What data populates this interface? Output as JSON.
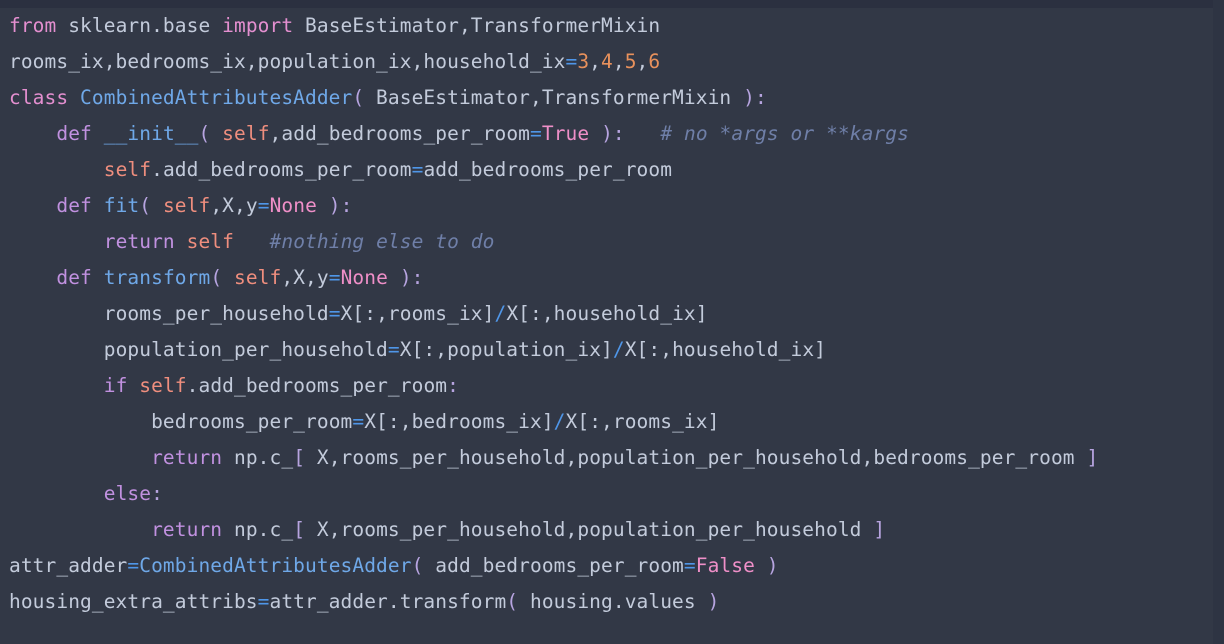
{
  "editor": {
    "language": "python",
    "background_color": "#323846",
    "gutter_color": "#2b3040",
    "scrollbar_color": "#2e3443",
    "theme_colors": {
      "keyword": "#c191e0",
      "keyword_declaration": "#e48fd0",
      "constant": "#ef8fc8",
      "self": "#ef8e7e",
      "function": "#6fa8e8",
      "number": "#e8915c",
      "operator": "#4f96e8",
      "punctuation": "#b7a4e0",
      "identifier": "#c3cbdb",
      "comment": "#6f7fa8"
    }
  },
  "code": {
    "lines": [
      {
        "n": 1,
        "text": "from sklearn.base import BaseEstimator,TransformerMixin",
        "tokens": [
          {
            "t": "from",
            "c": "kw2"
          },
          {
            "t": " sklearn.base ",
            "c": "id"
          },
          {
            "t": "import",
            "c": "kw2"
          },
          {
            "t": " BaseEstimator,TransformerMixin",
            "c": "id"
          }
        ]
      },
      {
        "n": 2,
        "text": "rooms_ix,bedrooms_ix,population_ix,household_ix=3,4,5,6",
        "tokens": [
          {
            "t": "rooms_ix,bedrooms_ix,population_ix,household_ix",
            "c": "id"
          },
          {
            "t": "=",
            "c": "op"
          },
          {
            "t": "3",
            "c": "num"
          },
          {
            "t": ",",
            "c": "id"
          },
          {
            "t": "4",
            "c": "num"
          },
          {
            "t": ",",
            "c": "id"
          },
          {
            "t": "5",
            "c": "num"
          },
          {
            "t": ",",
            "c": "id"
          },
          {
            "t": "6",
            "c": "num"
          }
        ]
      },
      {
        "n": 3,
        "text": "class CombinedAttributesAdder( BaseEstimator,TransformerMixin ):",
        "tokens": [
          {
            "t": "class",
            "c": "kw2"
          },
          {
            "t": " ",
            "c": "id"
          },
          {
            "t": "CombinedAttributesAdder",
            "c": "fn"
          },
          {
            "t": "(",
            "c": "punc"
          },
          {
            "t": " BaseEstimator,TransformerMixin ",
            "c": "id"
          },
          {
            "t": "):",
            "c": "punc"
          }
        ]
      },
      {
        "n": 4,
        "text": "    def __init__( self,add_bedrooms_per_room=True ):   # no *args or **kargs",
        "tokens": [
          {
            "t": "    ",
            "c": "id"
          },
          {
            "t": "def",
            "c": "kw"
          },
          {
            "t": " ",
            "c": "id"
          },
          {
            "t": "__init__",
            "c": "fn"
          },
          {
            "t": "(",
            "c": "punc"
          },
          {
            "t": " ",
            "c": "id"
          },
          {
            "t": "self",
            "c": "self"
          },
          {
            "t": ",add_bedrooms_per_room",
            "c": "id"
          },
          {
            "t": "=",
            "c": "op"
          },
          {
            "t": "True",
            "c": "const"
          },
          {
            "t": " ",
            "c": "id"
          },
          {
            "t": "):",
            "c": "punc"
          },
          {
            "t": "   ",
            "c": "id"
          },
          {
            "t": "# no *args or **kargs",
            "c": "cmt"
          }
        ]
      },
      {
        "n": 5,
        "text": "        self.add_bedrooms_per_room=add_bedrooms_per_room",
        "tokens": [
          {
            "t": "        ",
            "c": "id"
          },
          {
            "t": "self",
            "c": "self"
          },
          {
            "t": ".add_bedrooms_per_room",
            "c": "id"
          },
          {
            "t": "=",
            "c": "op"
          },
          {
            "t": "add_bedrooms_per_room",
            "c": "id"
          }
        ]
      },
      {
        "n": 6,
        "text": "    def fit( self,X,y=None ):",
        "tokens": [
          {
            "t": "    ",
            "c": "id"
          },
          {
            "t": "def",
            "c": "kw"
          },
          {
            "t": " ",
            "c": "id"
          },
          {
            "t": "fit",
            "c": "fn"
          },
          {
            "t": "(",
            "c": "punc"
          },
          {
            "t": " ",
            "c": "id"
          },
          {
            "t": "self",
            "c": "self"
          },
          {
            "t": ",X,y",
            "c": "id"
          },
          {
            "t": "=",
            "c": "op"
          },
          {
            "t": "None",
            "c": "const"
          },
          {
            "t": " ",
            "c": "id"
          },
          {
            "t": "):",
            "c": "punc"
          }
        ]
      },
      {
        "n": 7,
        "text": "        return self   #nothing else to do",
        "tokens": [
          {
            "t": "        ",
            "c": "id"
          },
          {
            "t": "return",
            "c": "kw"
          },
          {
            "t": " ",
            "c": "id"
          },
          {
            "t": "self",
            "c": "self"
          },
          {
            "t": "   ",
            "c": "id"
          },
          {
            "t": "#nothing else to do",
            "c": "cmt"
          }
        ]
      },
      {
        "n": 8,
        "text": "    def transform( self,X,y=None ):",
        "tokens": [
          {
            "t": "    ",
            "c": "id"
          },
          {
            "t": "def",
            "c": "kw"
          },
          {
            "t": " ",
            "c": "id"
          },
          {
            "t": "transform",
            "c": "fn"
          },
          {
            "t": "(",
            "c": "punc"
          },
          {
            "t": " ",
            "c": "id"
          },
          {
            "t": "self",
            "c": "self"
          },
          {
            "t": ",X,y",
            "c": "id"
          },
          {
            "t": "=",
            "c": "op"
          },
          {
            "t": "None",
            "c": "const"
          },
          {
            "t": " ",
            "c": "id"
          },
          {
            "t": "):",
            "c": "punc"
          }
        ]
      },
      {
        "n": 9,
        "text": "        rooms_per_household=X[:,rooms_ix]/X[:,household_ix]",
        "tokens": [
          {
            "t": "        ",
            "c": "id"
          },
          {
            "t": "rooms_per_household",
            "c": "id"
          },
          {
            "t": "=",
            "c": "op"
          },
          {
            "t": "X[:,rooms_ix]",
            "c": "id"
          },
          {
            "t": "/",
            "c": "op"
          },
          {
            "t": "X[:,household_ix]",
            "c": "id"
          }
        ]
      },
      {
        "n": 10,
        "text": "        population_per_household=X[:,population_ix]/X[:,household_ix]",
        "tokens": [
          {
            "t": "        ",
            "c": "id"
          },
          {
            "t": "population_per_household",
            "c": "id"
          },
          {
            "t": "=",
            "c": "op"
          },
          {
            "t": "X[:,population_ix]",
            "c": "id"
          },
          {
            "t": "/",
            "c": "op"
          },
          {
            "t": "X[:,household_ix]",
            "c": "id"
          }
        ]
      },
      {
        "n": 11,
        "text": "        if self.add_bedrooms_per_room:",
        "tokens": [
          {
            "t": "        ",
            "c": "id"
          },
          {
            "t": "if",
            "c": "kw"
          },
          {
            "t": " ",
            "c": "id"
          },
          {
            "t": "self",
            "c": "self"
          },
          {
            "t": ".add_bedrooms_per_room",
            "c": "id"
          },
          {
            "t": ":",
            "c": "punc"
          }
        ]
      },
      {
        "n": 12,
        "text": "            bedrooms_per_room=X[:,bedrooms_ix]/X[:,rooms_ix]",
        "tokens": [
          {
            "t": "            ",
            "c": "id"
          },
          {
            "t": "bedrooms_per_room",
            "c": "id"
          },
          {
            "t": "=",
            "c": "op"
          },
          {
            "t": "X[:,bedrooms_ix]",
            "c": "id"
          },
          {
            "t": "/",
            "c": "op"
          },
          {
            "t": "X[:,rooms_ix]",
            "c": "id"
          }
        ]
      },
      {
        "n": 13,
        "text": "            return np.c_[ X,rooms_per_household,population_per_household,bedrooms_per_room ]",
        "tokens": [
          {
            "t": "            ",
            "c": "id"
          },
          {
            "t": "return",
            "c": "kw"
          },
          {
            "t": " np.c_",
            "c": "id"
          },
          {
            "t": "[",
            "c": "punc"
          },
          {
            "t": " X,rooms_per_household,population_per_household,bedrooms_per_room ",
            "c": "id"
          },
          {
            "t": "]",
            "c": "punc"
          }
        ]
      },
      {
        "n": 14,
        "text": "        else:",
        "tokens": [
          {
            "t": "        ",
            "c": "id"
          },
          {
            "t": "else",
            "c": "kw"
          },
          {
            "t": ":",
            "c": "punc"
          }
        ]
      },
      {
        "n": 15,
        "text": "            return np.c_[ X,rooms_per_household,population_per_household ]",
        "tokens": [
          {
            "t": "            ",
            "c": "id"
          },
          {
            "t": "return",
            "c": "kw"
          },
          {
            "t": " np.c_",
            "c": "id"
          },
          {
            "t": "[",
            "c": "punc"
          },
          {
            "t": " X,rooms_per_household,population_per_household ",
            "c": "id"
          },
          {
            "t": "]",
            "c": "punc"
          }
        ]
      },
      {
        "n": 16,
        "text": "attr_adder=CombinedAttributesAdder( add_bedrooms_per_room=False )",
        "tokens": [
          {
            "t": "attr_adder",
            "c": "id"
          },
          {
            "t": "=",
            "c": "op"
          },
          {
            "t": "CombinedAttributesAdder",
            "c": "fn"
          },
          {
            "t": "(",
            "c": "punc"
          },
          {
            "t": " add_bedrooms_per_room",
            "c": "id"
          },
          {
            "t": "=",
            "c": "op"
          },
          {
            "t": "False",
            "c": "const"
          },
          {
            "t": " ",
            "c": "id"
          },
          {
            "t": ")",
            "c": "punc"
          }
        ]
      },
      {
        "n": 17,
        "text": "housing_extra_attribs=attr_adder.transform( housing.values )",
        "tokens": [
          {
            "t": "housing_extra_attribs",
            "c": "id"
          },
          {
            "t": "=",
            "c": "op"
          },
          {
            "t": "attr_adder.transform",
            "c": "id"
          },
          {
            "t": "(",
            "c": "punc"
          },
          {
            "t": " housing.values ",
            "c": "id"
          },
          {
            "t": ")",
            "c": "punc"
          }
        ]
      }
    ]
  }
}
